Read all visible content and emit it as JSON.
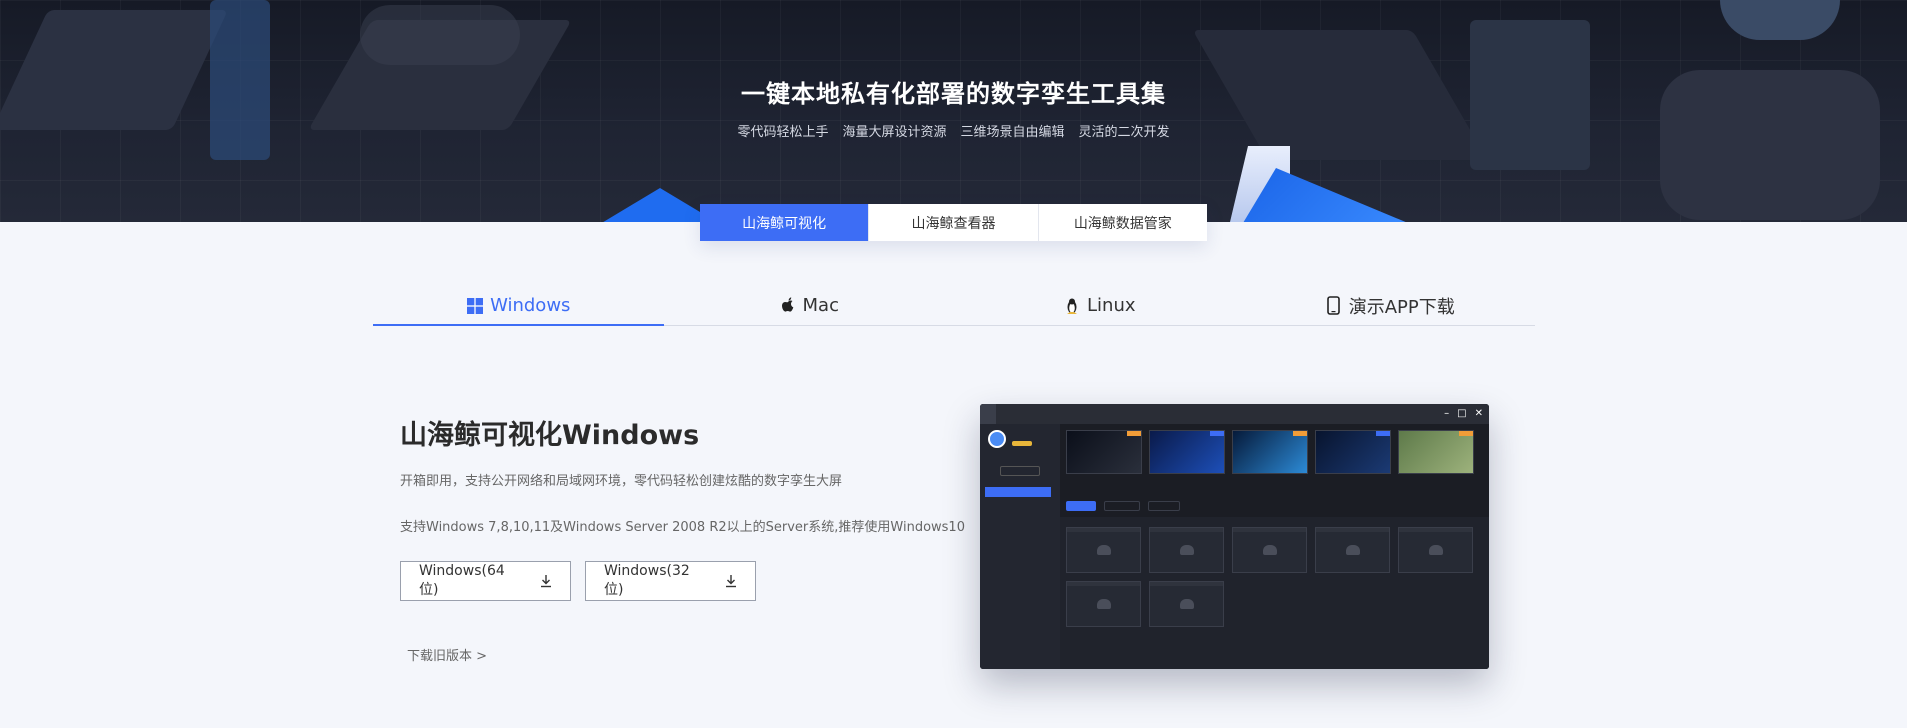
{
  "hero": {
    "title": "一键本地私有化部署的数字孪生工具集",
    "features": [
      "零代码轻松上手",
      "海量大屏设计资源",
      "三维场景自由编辑",
      "灵活的二次开发"
    ]
  },
  "product_tabs": [
    {
      "label": "山海鲸可视化",
      "active": true
    },
    {
      "label": "山海鲸查看器",
      "active": false
    },
    {
      "label": "山海鲸数据管家",
      "active": false
    }
  ],
  "os_tabs": [
    {
      "label": "Windows",
      "icon": "windows-icon",
      "active": true
    },
    {
      "label": "Mac",
      "icon": "apple-icon",
      "active": false
    },
    {
      "label": "Linux",
      "icon": "linux-icon",
      "active": false
    },
    {
      "label": "演示APP下载",
      "icon": "phone-icon",
      "active": false
    }
  ],
  "content": {
    "title": "山海鲸可视化Windows",
    "desc1": "开箱即用，支持公开网络和局域网环境，零代码轻松创建炫酷的数字孪生大屏",
    "desc2": "支持Windows 7,8,10,11及Windows Server 2008 R2以上的Server系统,推荐使用Windows10",
    "download_64": "Windows(64位)",
    "download_32": "Windows(32位)",
    "old_versions": "下载旧版本 >"
  },
  "colors": {
    "accent": "#3d6df5",
    "hero_bg": "#1f2433",
    "page_bg": "#f4f6fb"
  }
}
